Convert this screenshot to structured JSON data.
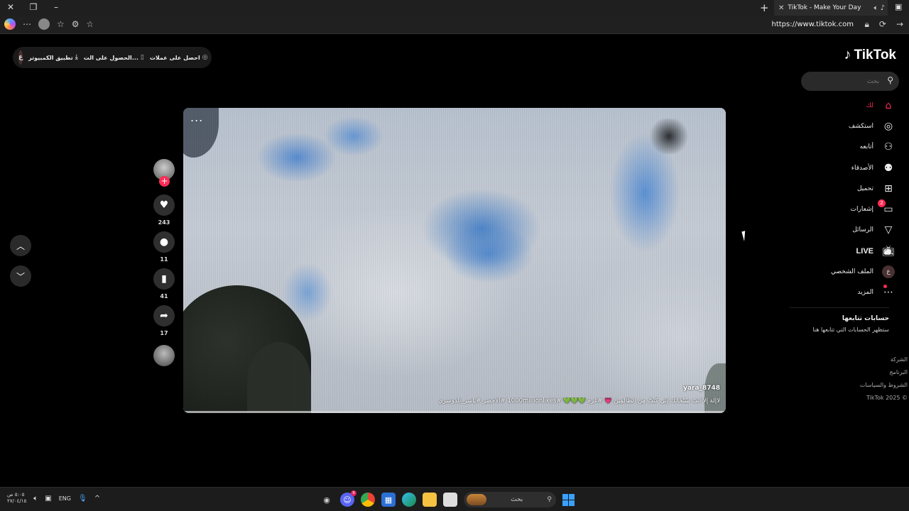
{
  "browser": {
    "tab_title": "TikTok - Make Your Day",
    "url": "https://www.tiktok.com"
  },
  "top_bar": {
    "avatar_letter": "ع",
    "items": [
      "تطبيق الكمبيوتر",
      "الحصول على الت...",
      "احصل على عملات"
    ]
  },
  "logo": "TikTok",
  "search": {
    "placeholder": "بحث"
  },
  "nav": [
    {
      "label": "لك",
      "icon": "home-icon",
      "active": true
    },
    {
      "label": "استكشف",
      "icon": "compass-icon"
    },
    {
      "label": "أتابعه",
      "icon": "user-plus-icon"
    },
    {
      "label": "الأصدقاء",
      "icon": "friends-icon"
    },
    {
      "label": "تحميل",
      "icon": "upload-icon"
    },
    {
      "label": "إشعارات",
      "icon": "inbox-icon",
      "badge": "2"
    },
    {
      "label": "الرسائل",
      "icon": "paper-plane-icon"
    },
    {
      "label": "LIVE",
      "icon": "live-tv-icon"
    },
    {
      "label": "الملف الشخصي",
      "icon": "profile-avatar",
      "avatar_letter": "ع"
    },
    {
      "label": "المزيد",
      "icon": "more-dots-icon"
    }
  ],
  "following": {
    "title": "حسابات تتابعها",
    "subtitle": "ستظهر الحسابات التي تتابعها هنا"
  },
  "footer": [
    "الشركة",
    "البرنامج",
    "الشروط والسياسات",
    "TikTok 2025 ©"
  ],
  "video": {
    "more": "...",
    "username": "yara_8748",
    "caption": "لَاإِلَهَ إِلَّا أَنْتَ سُبْحَانَكَ إِنِّي كُنْتُ مِنَ الظَّالِمِينَ 💗 #غزة 💚💚💚 #1000millionlikes #الاخضر #ياسر_الدوسري",
    "progress": 0.0
  },
  "actions": {
    "likes": "243",
    "comments": "11",
    "saves": "41",
    "shares": "17"
  },
  "taskbar": {
    "time": "٥:٠٥ ص",
    "date": "٢٧/٠٤/١٥",
    "lang": "ENG",
    "search_placeholder": "بحث",
    "discord_badge": "9"
  },
  "colors": {
    "accent": "#fe2c55",
    "background": "#000000"
  }
}
